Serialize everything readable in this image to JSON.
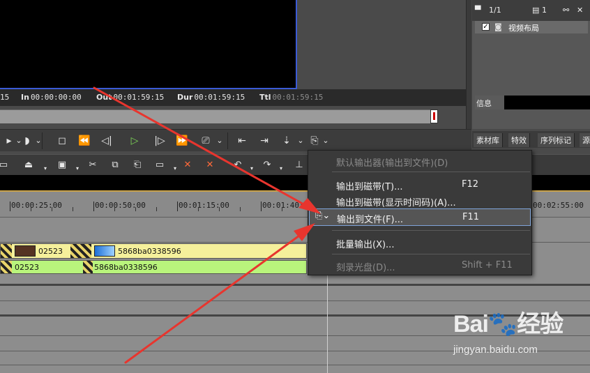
{
  "timecodes": {
    "cur_tail": "15",
    "in_label": "In",
    "in_value": "00:00:00:00",
    "out_label": "Out",
    "out_value": "00:01:59:15",
    "dur_label": "Dur",
    "dur_value": "00:01:59:15",
    "ttl_label": "Ttl",
    "ttl_value": "00:01:59:15"
  },
  "right_panel": {
    "page": "1/1",
    "count": "1",
    "layout_item": "视频布局",
    "info_label": "信息",
    "tabs": [
      "素材库",
      "特效",
      "序列标记",
      "源"
    ]
  },
  "ruler": {
    "ticks": [
      "00:00:25:00",
      "00:00:50:00",
      "00:01:15:00",
      "00:01:40:00",
      "00:02:55:00"
    ]
  },
  "tracks": {
    "clip1_video": "02523",
    "clip2_video": "5868ba0338596",
    "clip1_audio": "02523",
    "clip2_audio": "5868ba0338596"
  },
  "menu": {
    "items": [
      {
        "label": "默认输出器(输出到文件)(D)",
        "shortcut": "",
        "disabled": true
      },
      {
        "label": "输出到磁带(T)...",
        "shortcut": "F12",
        "disabled": false
      },
      {
        "label": "输出到磁带(显示时间码)(A)...",
        "shortcut": "",
        "disabled": false
      },
      {
        "label": "输出到文件(F)...",
        "shortcut": "F11",
        "disabled": false,
        "highlighted": true
      },
      {
        "label": "批量输出(X)...",
        "shortcut": "",
        "disabled": false
      },
      {
        "label": "刻录光盘(D)...",
        "shortcut": "Shift + F11",
        "disabled": true
      }
    ]
  },
  "watermark": {
    "brand": "Bai",
    "brand_suffix": "经验",
    "url": "jingyan.baidu.com"
  },
  "colors": {
    "arrow": "#e8352e",
    "video_clip": "#f5f09b",
    "audio_clip": "#b9f47c",
    "play_green": "#7ed957"
  }
}
